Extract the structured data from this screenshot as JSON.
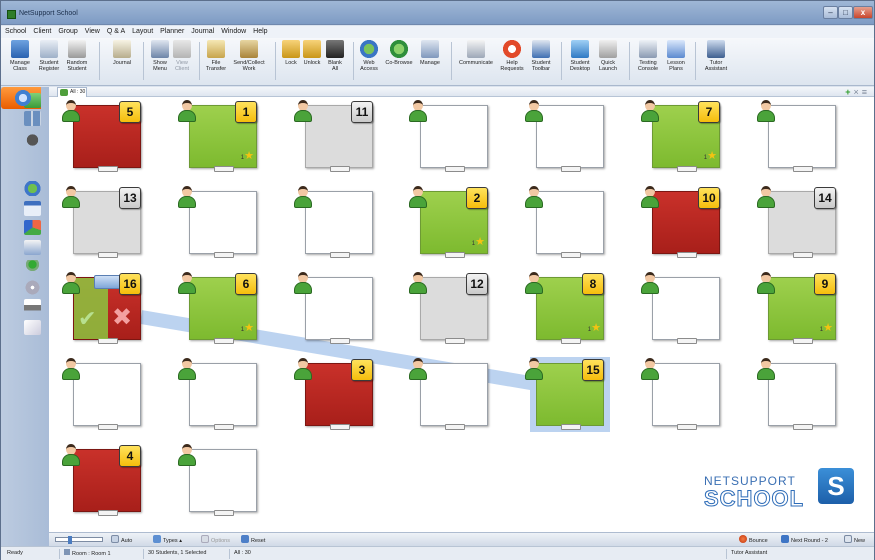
{
  "window": {
    "title": "NetSupport School",
    "min": "–",
    "max": "□",
    "close": "x"
  },
  "menu": [
    "School",
    "Client",
    "Group",
    "View",
    "Q & A",
    "Layout",
    "Planner",
    "Journal",
    "Window",
    "Help"
  ],
  "toolbar": {
    "manage_class": [
      "Manage",
      "Class"
    ],
    "student_register": [
      "Student",
      "Register"
    ],
    "random_student": [
      "Random",
      "Student"
    ],
    "journal": [
      "Journal"
    ],
    "show": [
      "Show",
      "Menu"
    ],
    "view": [
      "View",
      "Client"
    ],
    "file_transfer": [
      "File",
      "Transfer"
    ],
    "send_collect": [
      "Send/Collect",
      "Work"
    ],
    "lock": [
      "Lock"
    ],
    "unlock": [
      "Unlock"
    ],
    "blank_all": [
      "Blank",
      "All"
    ],
    "web_access": [
      "Web",
      "Access"
    ],
    "co_browse": [
      "Co-Browse"
    ],
    "manage": [
      "Manage"
    ],
    "communicate": [
      "Communicate"
    ],
    "help_requests": [
      "Help",
      "Requests"
    ],
    "student_toolbar": [
      "Student",
      "Toolbar"
    ],
    "student_desktop": [
      "Student",
      "Desktop"
    ],
    "quick_launch": [
      "Quick",
      "Launch"
    ],
    "testing_console": [
      "Testing",
      "Console"
    ],
    "lesson_plans": [
      "Lesson",
      "Plans"
    ],
    "tutor_assistant": [
      "Tutor",
      "Assistant"
    ]
  },
  "tabs": {
    "all": "All : 30"
  },
  "seats": [
    {
      "id": "5",
      "state": "red",
      "star": false
    },
    {
      "id": "1",
      "state": "green",
      "star": true
    },
    {
      "id": "11",
      "state": "grey",
      "star": false
    },
    {
      "id": "",
      "state": "white",
      "star": false
    },
    {
      "id": "",
      "state": "white",
      "star": false
    },
    {
      "id": "7",
      "state": "green",
      "star": true
    },
    {
      "id": "",
      "state": "white",
      "star": false
    },
    {
      "id": "13",
      "state": "grey",
      "star": false
    },
    {
      "id": "",
      "state": "white",
      "star": false
    },
    {
      "id": "",
      "state": "white",
      "star": false
    },
    {
      "id": "2",
      "state": "green",
      "star": true
    },
    {
      "id": "",
      "state": "white",
      "star": false
    },
    {
      "id": "10",
      "state": "red",
      "star": false
    },
    {
      "id": "14",
      "state": "grey",
      "star": false
    },
    {
      "id": "16",
      "state": "red",
      "star": false
    },
    {
      "id": "6",
      "state": "green",
      "star": true
    },
    {
      "id": "",
      "state": "white",
      "star": false
    },
    {
      "id": "12",
      "state": "grey",
      "star": false
    },
    {
      "id": "8",
      "state": "green",
      "star": true
    },
    {
      "id": "",
      "state": "white",
      "star": false
    },
    {
      "id": "9",
      "state": "green",
      "star": true
    },
    {
      "id": "",
      "state": "white",
      "star": false
    },
    {
      "id": "",
      "state": "white",
      "star": false
    },
    {
      "id": "3",
      "state": "red",
      "star": false
    },
    {
      "id": "",
      "state": "white",
      "star": false
    },
    {
      "id": "15",
      "state": "green",
      "star": false
    },
    {
      "id": "",
      "state": "white",
      "star": false
    },
    {
      "id": "",
      "state": "white",
      "star": false
    },
    {
      "id": "4",
      "state": "red",
      "star": false
    },
    {
      "id": "",
      "state": "white",
      "star": false
    }
  ],
  "star_count": "1",
  "logo": {
    "line1": "NETSUPPORT",
    "line2": "SCHOOL",
    "mark": "S"
  },
  "bottom": {
    "auto": "Auto",
    "types": "Types",
    "options": "Options",
    "reset": "Reset",
    "bounce": "Bounce",
    "next_round": "Next Round - 2",
    "new": "New"
  },
  "status": {
    "ready": "Ready",
    "room": "Room : Room 1",
    "students": "30 Students, 1 Selected",
    "all": "All : 30",
    "tutor": "Tutor Assistant"
  }
}
